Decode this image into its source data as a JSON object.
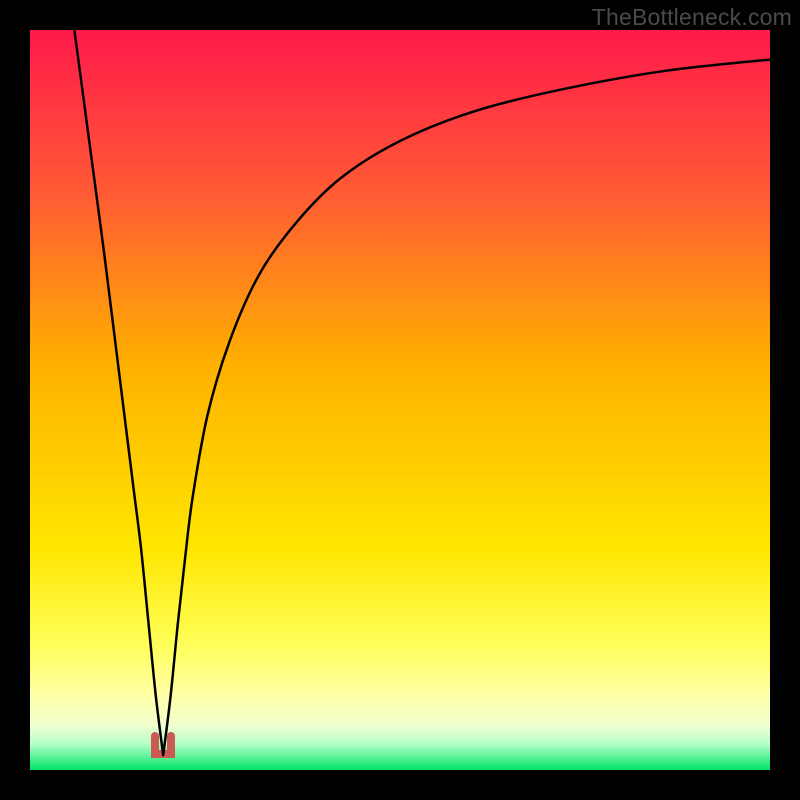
{
  "watermark": "TheBottleneck.com",
  "colors": {
    "frame": "#000000",
    "curve": "#000000",
    "marker": "#cb5a53",
    "gradient_top": "#ff1a4b",
    "gradient_mid_upper": "#ff7a2e",
    "gradient_mid": "#ffd900",
    "gradient_mid_lower": "#ffff4d",
    "gradient_lower": "#f6ffb0",
    "gradient_bottom": "#00e56a"
  },
  "chart_data": {
    "type": "line",
    "title": "",
    "xlabel": "",
    "ylabel": "",
    "xlim": [
      0,
      100
    ],
    "ylim": [
      0,
      100
    ],
    "grid": false,
    "legend": false,
    "minimum_x": 18,
    "minimum_y": 2,
    "series": [
      {
        "name": "curve",
        "x": [
          6,
          8,
          10,
          12,
          14,
          15,
          16,
          17,
          18,
          19,
          20,
          21,
          22,
          24,
          27,
          31,
          36,
          42,
          50,
          60,
          72,
          86,
          100
        ],
        "y": [
          100,
          85,
          70,
          54,
          38,
          30,
          20,
          10,
          2,
          10,
          20,
          29,
          37,
          48,
          58,
          67,
          74,
          80,
          85,
          89,
          92,
          94.5,
          96
        ]
      }
    ],
    "gradient_stops": [
      {
        "pos": 0.0,
        "color": "#ff1a4b"
      },
      {
        "pos": 0.22,
        "color": "#ff5a34"
      },
      {
        "pos": 0.45,
        "color": "#ffb000"
      },
      {
        "pos": 0.7,
        "color": "#ffe600"
      },
      {
        "pos": 0.83,
        "color": "#ffff59"
      },
      {
        "pos": 0.9,
        "color": "#ffffa8"
      },
      {
        "pos": 0.94,
        "color": "#f0ffd0"
      },
      {
        "pos": 0.965,
        "color": "#b4ffc8"
      },
      {
        "pos": 0.985,
        "color": "#4cf08f"
      },
      {
        "pos": 1.0,
        "color": "#00e56a"
      }
    ],
    "marker": {
      "shape": "u",
      "x_center": 18,
      "width_x": 3.2,
      "top_y": 5.2,
      "bottom_y": 1.6
    }
  }
}
